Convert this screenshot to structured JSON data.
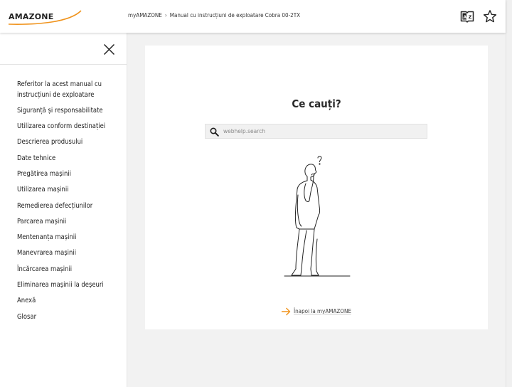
{
  "header": {
    "logo_text": "AMAZONE",
    "breadcrumb": {
      "home": "myAMAZONE",
      "separator": "›",
      "current": "Manual cu instrucțiuni de exploatare Cobra 00-2TX"
    },
    "icons": [
      "dictionary-icon",
      "star-icon"
    ]
  },
  "sidebar": {
    "close_icon": "close-icon",
    "items": [
      {
        "label": "Referitor la acest manual cu instrucțiuni de exploatare"
      },
      {
        "label": "Siguranță și responsabilitate"
      },
      {
        "label": "Utilizarea conform destinației"
      },
      {
        "label": "Descrierea produsului"
      },
      {
        "label": "Date tehnice"
      },
      {
        "label": "Pregătirea mașinii"
      },
      {
        "label": "Utilizarea mașinii"
      },
      {
        "label": "Remedierea defecțiunilor"
      },
      {
        "label": "Parcarea mașinii"
      },
      {
        "label": "Mentenanța mașinii"
      },
      {
        "label": "Manevrarea mașinii"
      },
      {
        "label": "Încărcarea mașinii"
      },
      {
        "label": "Eliminarea mașinii la deșeuri"
      },
      {
        "label": "Anexă"
      },
      {
        "label": "Glosar"
      }
    ]
  },
  "main": {
    "title": "Ce cauți?",
    "search": {
      "placeholder": "webhelp.search",
      "value": ""
    },
    "back_link": "Înapoi la myAMAZONE"
  },
  "colors": {
    "brand_orange": "#f0941e",
    "logo_dark": "#222222",
    "background": "#f2f2f2",
    "card": "#ffffff"
  }
}
